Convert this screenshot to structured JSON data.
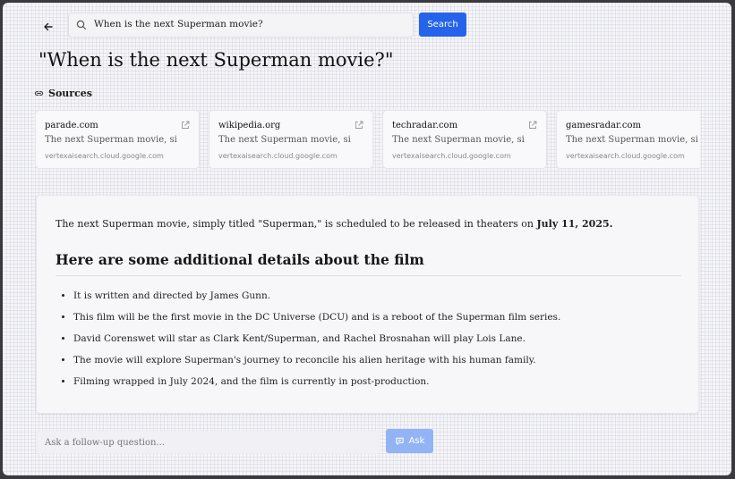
{
  "header": {
    "search_value": "When is the next Superman movie?",
    "search_button": "Search"
  },
  "page_title": "\"When is the next Superman movie?\"",
  "sources": {
    "label": "Sources",
    "cards": [
      {
        "domain": "parade.com",
        "snippet": "The next Superman movie, simply",
        "host": "vertexaisearch.cloud.google.com"
      },
      {
        "domain": "wikipedia.org",
        "snippet": "The next Superman movie, simply",
        "host": "vertexaisearch.cloud.google.com"
      },
      {
        "domain": "techradar.com",
        "snippet": "The next Superman movie, simply",
        "host": "vertexaisearch.cloud.google.com"
      },
      {
        "domain": "gamesradar.com",
        "snippet": "The next Superman movie, simply",
        "host": "vertexaisearch.cloud.google.com"
      }
    ]
  },
  "answer": {
    "intro": "The next Superman movie, simply titled \"Superman,\" is scheduled to be released in theaters on ",
    "intro_date": "July 11, 2025.",
    "heading": "Here are some additional details about the film",
    "bullets": [
      "It is written and directed by James Gunn.",
      "This film will be the first movie in the DC Universe (DCU) and is a reboot of the Superman film series.",
      "David Corenswet will star as Clark Kent/Superman, and Rachel Brosnahan will play Lois Lane.",
      "The movie will explore Superman's journey to reconcile his alien heritage with his human family.",
      "Filming wrapped in July 2024, and the film is currently in post-production."
    ]
  },
  "followup": {
    "placeholder": "Ask a follow-up question...",
    "button": "Ask"
  },
  "colors": {
    "accent": "#2563eb",
    "accent_disabled": "#93b4f4"
  },
  "icons": {
    "back": "arrow-left-icon",
    "search": "search-icon",
    "sources": "link-icon",
    "external": "external-link-icon",
    "ask": "chat-icon"
  }
}
